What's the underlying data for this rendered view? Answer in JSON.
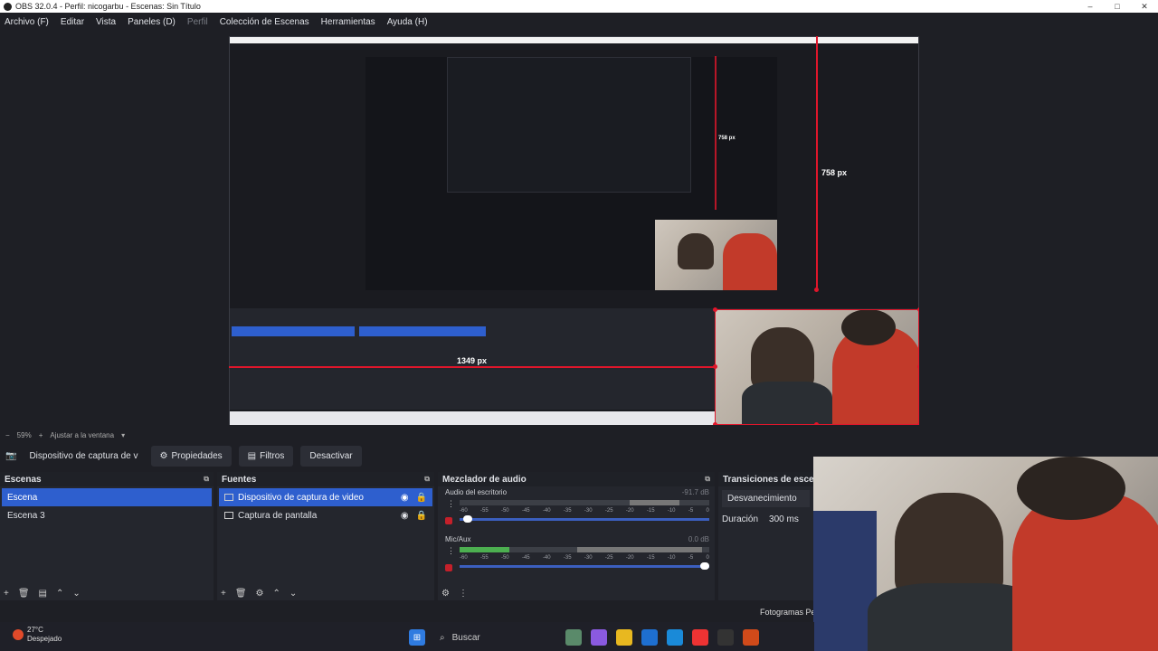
{
  "window": {
    "title": "OBS 32.0.4 - Perfil: nicogarbu - Escenas: Sin Título",
    "minimize": "–",
    "maximize": "□",
    "close": "✕"
  },
  "menu": [
    "Archivo (F)",
    "Editar",
    "Vista",
    "Paneles (D)",
    "Perfil",
    "Colección de Escenas",
    "Herramientas",
    "Ayuda (H)"
  ],
  "preview": {
    "height_label": "758 px",
    "width_label": "1349 px",
    "nested_height_label": "758 px"
  },
  "zoom": {
    "level": "59%",
    "fit": "Ajustar a la ventana"
  },
  "source_toolbar": {
    "selected_source": "Dispositivo de captura de v",
    "properties": "Propiedades",
    "filters": "Filtros",
    "deactivate": "Desactivar"
  },
  "scenes": {
    "title": "Escenas",
    "items": [
      "Escena",
      "Escena 3"
    ],
    "selected_index": 0
  },
  "sources": {
    "title": "Fuentes",
    "items": [
      "Dispositivo de captura de video",
      "Captura de pantalla"
    ],
    "selected_index": 0
  },
  "mixer": {
    "title": "Mezclador de audio",
    "channels": [
      {
        "name": "Audio del escritorio",
        "db": "-91.7 dB",
        "level": 0.0,
        "volume": 0.05
      },
      {
        "name": "Mic/Aux",
        "db": "0.0 dB",
        "level": 0.2,
        "volume": 1.0
      }
    ],
    "ticks": [
      "-60",
      "-55",
      "-50",
      "-45",
      "-40",
      "-35",
      "-30",
      "-25",
      "-20",
      "-15",
      "-10",
      "-5",
      "0"
    ]
  },
  "transitions": {
    "title": "Transiciones de escena",
    "type": "Desvanecimiento",
    "duration_label": "Duración",
    "duration": "300 ms"
  },
  "status": {
    "fps_label": "Fotogramas Pe"
  },
  "taskbar": {
    "temperature": "27°C",
    "condition": "Despejado",
    "search": "Buscar"
  },
  "colors": {
    "accent": "#2e5fce",
    "selection_red": "#e0162b",
    "background": "#1e1f25"
  }
}
